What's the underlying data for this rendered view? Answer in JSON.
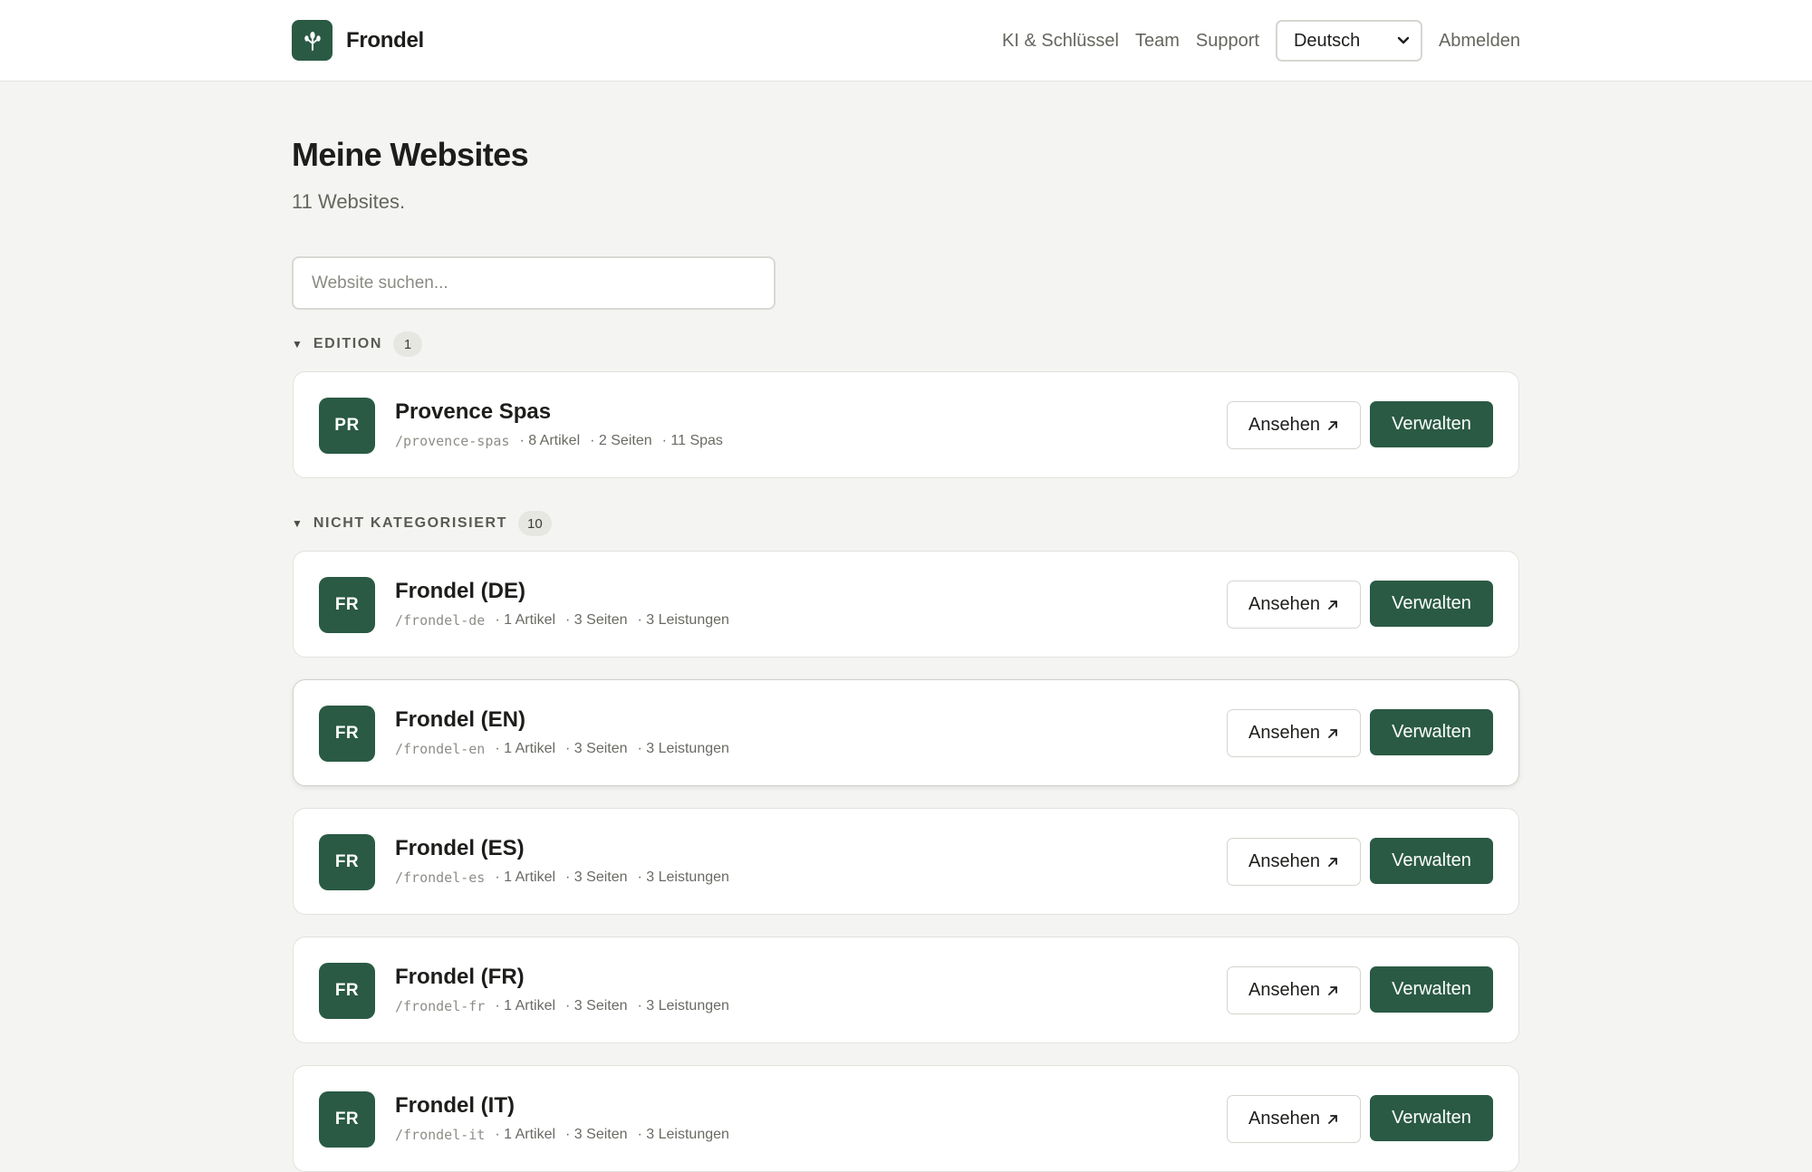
{
  "app": {
    "name": "Frondel",
    "logo_icon": "sprout-icon",
    "brand_color": "#2a5a44"
  },
  "nav": {
    "links": [
      "KI & Schlüssel",
      "Team",
      "Support"
    ],
    "language": "Deutsch",
    "logout": "Abmelden"
  },
  "page": {
    "title": "Meine Websites",
    "subtitle": "11 Websites."
  },
  "search": {
    "placeholder": "Website suchen..."
  },
  "groups": [
    {
      "title": "EDITION",
      "count": "1",
      "sites": [
        {
          "initials": "PR",
          "name": "Provence Spas",
          "slug": "/provence-spas",
          "stats": [
            "· 8 Artikel",
            "· 2 Seiten",
            "· 11 Spas"
          ]
        }
      ]
    },
    {
      "title": "NICHT KATEGORISIERT",
      "count": "10",
      "sites": [
        {
          "initials": "FR",
          "name": "Frondel (DE)",
          "slug": "/frondel-de",
          "stats": [
            "· 1 Artikel",
            "· 3 Seiten",
            "· 3 Leistungen"
          ]
        },
        {
          "initials": "FR",
          "name": "Frondel (EN)",
          "slug": "/frondel-en",
          "stats": [
            "· 1 Artikel",
            "· 3 Seiten",
            "· 3 Leistungen"
          ]
        },
        {
          "initials": "FR",
          "name": "Frondel (ES)",
          "slug": "/frondel-es",
          "stats": [
            "· 1 Artikel",
            "· 3 Seiten",
            "· 3 Leistungen"
          ]
        },
        {
          "initials": "FR",
          "name": "Frondel (FR)",
          "slug": "/frondel-fr",
          "stats": [
            "· 1 Artikel",
            "· 3 Seiten",
            "· 3 Leistungen"
          ]
        },
        {
          "initials": "FR",
          "name": "Frondel (IT)",
          "slug": "/frondel-it",
          "stats": [
            "· 1 Artikel",
            "· 3 Seiten",
            "· 3 Leistungen"
          ]
        }
      ]
    }
  ],
  "actions": {
    "view_label": "Ansehen",
    "view_icon": "external-link-icon",
    "manage_label": "Verwalten"
  }
}
